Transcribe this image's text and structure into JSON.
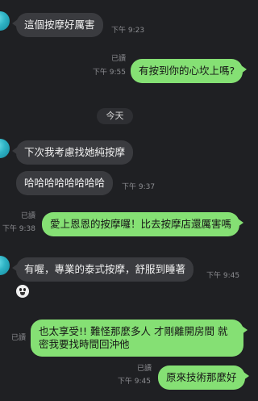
{
  "messages": [
    {
      "text": "這個按摩好厲害",
      "time": "下午 9:23"
    },
    {
      "text": "有按到你的心坎上嗎?",
      "read": "已讀",
      "time": "下午 9:55"
    },
    {
      "text": "下次我考慮找她純按摩"
    },
    {
      "text": "哈哈哈哈哈哈哈哈",
      "time": "下午 9:37"
    },
    {
      "text": "愛上恩恩的按摩囉！比去按摩店還厲害嗎",
      "read": "已讀",
      "time": "下午 9:38"
    },
    {
      "text": "有喔，專業的泰式按摩，舒服到睡著",
      "time": "下午 9:45"
    },
    {
      "text": "也太享受!! 難怪那麼多人 才剛離開房間 就密我要找時間回沖他",
      "read": "已讀"
    },
    {
      "text": "原來技術那麼好",
      "read": "已讀",
      "time": "下午 9:45"
    }
  ],
  "date_divider": "今天",
  "colors": {
    "background": "#1f2023",
    "incoming_bubble": "#3a3b3f",
    "outgoing_bubble": "#85e074"
  },
  "icons": [
    "contact-avatar-icon",
    "sticker-emoji-icon"
  ]
}
